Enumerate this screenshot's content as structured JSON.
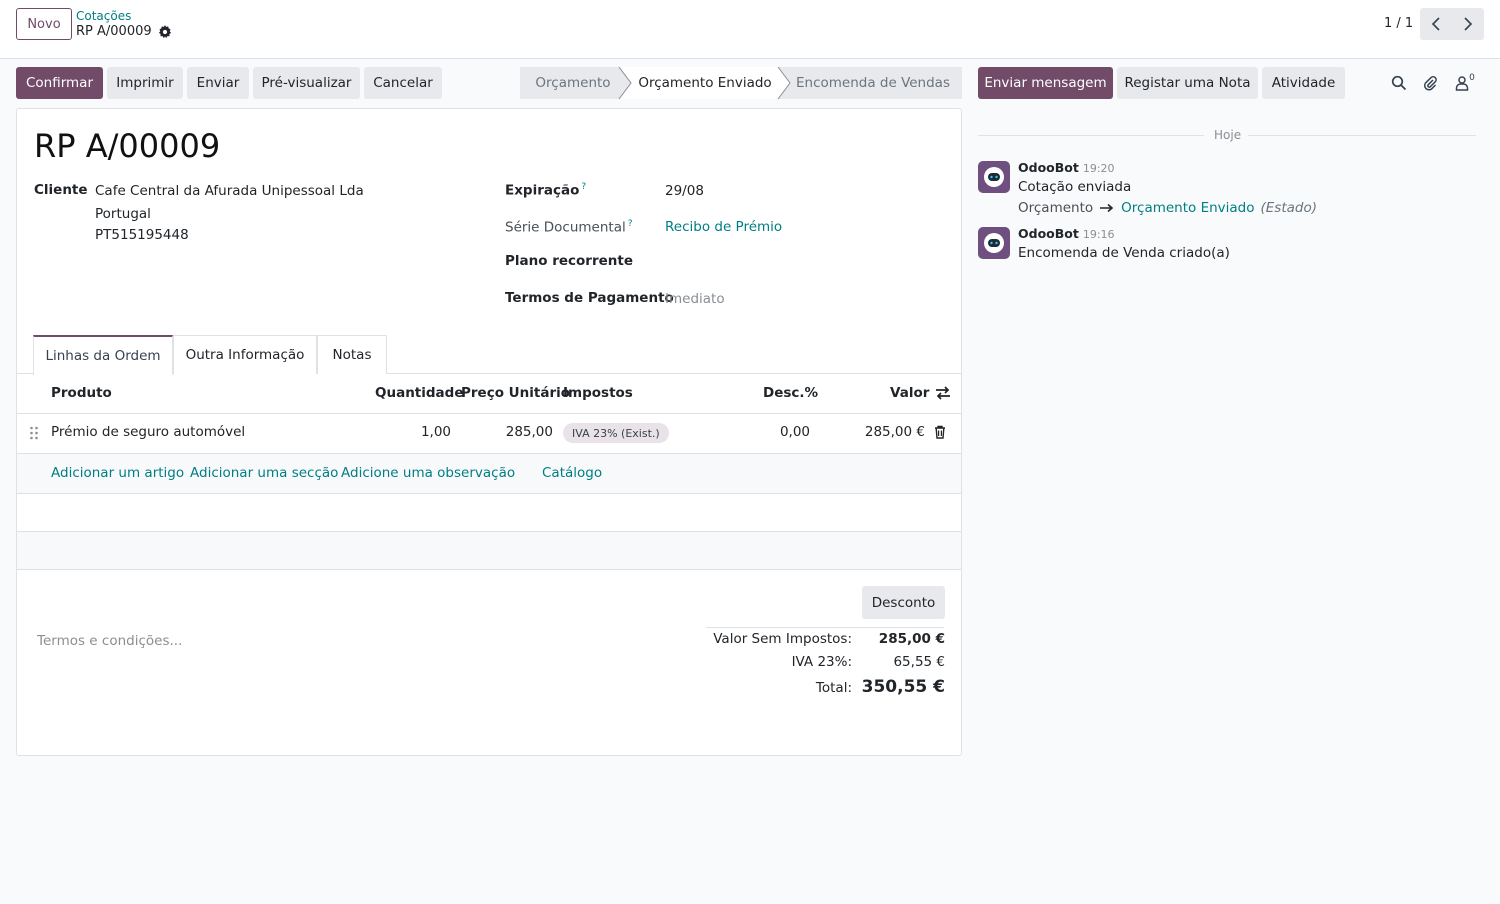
{
  "header": {
    "new_button": "Novo",
    "breadcrumb_parent": "Cotações",
    "breadcrumb_current": "RP A/00009",
    "pager": "1 / 1"
  },
  "actions": {
    "confirm": "Confirmar",
    "print": "Imprimir",
    "send": "Enviar",
    "preview": "Pré-visualizar",
    "cancel": "Cancelar"
  },
  "status": {
    "stages": [
      "Orçamento",
      "Orçamento Enviado",
      "Encomenda de Vendas"
    ],
    "active": "Orçamento Enviado"
  },
  "chatter_buttons": {
    "send_message": "Enviar mensagem",
    "log_note": "Registar uma Nota",
    "activity": "Atividade",
    "followers_count": "0"
  },
  "form": {
    "title": "RP A/00009",
    "customer_label": "Cliente",
    "customer_name": "Cafe Central da Afurada Unipessoal Lda",
    "customer_country": "Portugal",
    "customer_vat": "PT515195448",
    "expiration_label": "Expiração",
    "expiration_value": "29/08",
    "series_label": "Série Documental",
    "series_value": "Recibo de Prémio",
    "recurring_label": "Plano recorrente",
    "recurring_value": "",
    "payment_terms_label": "Termos de Pagamento",
    "payment_terms_value": "Imediato",
    "help_mark": "?"
  },
  "tabs": [
    "Linhas da Ordem",
    "Outra Informação",
    "Notas"
  ],
  "lines": {
    "headers": {
      "product": "Produto",
      "quantity": "Quantidade",
      "unit_price": "Preço Unitário",
      "taxes": "Impostos",
      "discount": "Desc.%",
      "amount": "Valor"
    },
    "rows": [
      {
        "product": "Prémio de seguro automóvel",
        "quantity": "1,00",
        "unit_price": "285,00",
        "tax": "IVA 23% (Exist.)",
        "discount": "0,00",
        "amount": "285,00 €"
      }
    ],
    "add_links": {
      "add_product": "Adicionar um artigo",
      "add_section": "Adicionar uma secção",
      "add_note": "Adicione uma observação",
      "catalog": "Catálogo"
    }
  },
  "footer": {
    "discount_button": "Desconto",
    "terms_placeholder": "Termos e condições...",
    "untaxed_label": "Valor Sem Impostos:",
    "untaxed_value": "285,00 €",
    "tax_label": "IVA 23%:",
    "tax_value": "65,55 €",
    "total_label": "Total:",
    "total_value": "350,55 €"
  },
  "chatter": {
    "today": "Hoje",
    "messages": [
      {
        "author": "OdooBot",
        "time": "19:20",
        "body": "Cotação enviada",
        "change_from": "Orçamento",
        "change_to": "Orçamento Enviado",
        "change_field": "(Estado)"
      },
      {
        "author": "OdooBot",
        "time": "19:16",
        "body": "Encomenda de Venda criado(a)"
      }
    ]
  },
  "colors": {
    "brand": "#714b67",
    "link": "#017e84",
    "gray_button": "#e7e9ed"
  }
}
